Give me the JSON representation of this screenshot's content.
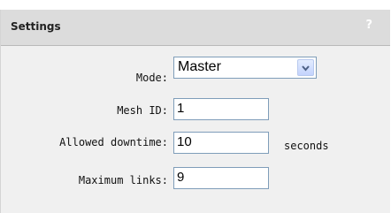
{
  "panel": {
    "title": "Settings",
    "help": "?"
  },
  "form": {
    "mode_label": "Mode:",
    "mode_value": "Master",
    "mesh_id_label": "Mesh ID:",
    "mesh_id_value": "1",
    "downtime_label": "Allowed downtime:",
    "downtime_value": "10",
    "downtime_unit": "seconds",
    "max_links_label": "Maximum links:",
    "max_links_value": "9"
  },
  "icons": {
    "help": "question-mark-icon",
    "dropdown": "chevron-down-icon"
  },
  "colors": {
    "header_bg": "#dcdcdc",
    "panel_bg": "#f0f0f0",
    "input_border": "#7f9db9"
  }
}
